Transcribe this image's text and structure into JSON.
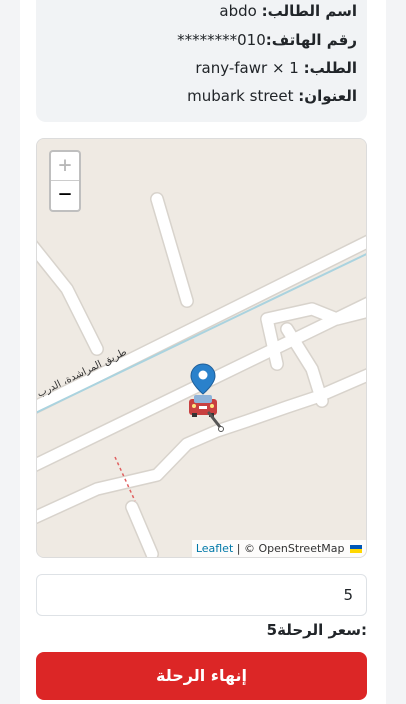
{
  "order_info": {
    "student_name_label": "اسم الطالب:",
    "student_name": "abdo",
    "phone_label": "رقم الهاتف:",
    "phone": "010********",
    "order_label": "الطلب:",
    "order": "rany-fawr × 1",
    "address_label": "العنوان:",
    "address": "mubark street"
  },
  "map": {
    "zoom_in": "+",
    "zoom_out": "−",
    "road_label": "طريق المراشدة، الدرب",
    "attribution_leaflet": "Leaflet",
    "attribution_separator": " | © ",
    "attribution_osm": "OpenStreetMap",
    "marker_icon": "map-pin-icon",
    "vehicle_icon": "car-icon"
  },
  "fare": {
    "input_value": "5",
    "label": ":سعر الرحلة5"
  },
  "actions": {
    "end_trip": "إنهاء الرحلة"
  },
  "colors": {
    "end_button": "#dc2626",
    "marker": "#2a81cb",
    "map_bg": "#efeae3",
    "road": "#ffffff",
    "waterway": "#aad3df"
  }
}
